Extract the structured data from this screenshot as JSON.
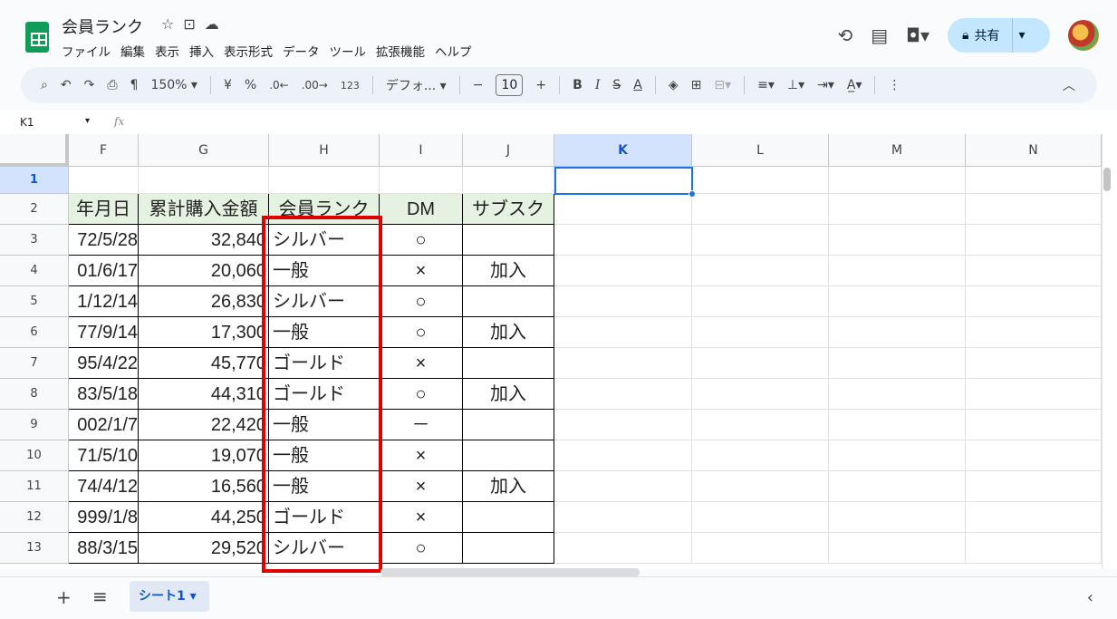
{
  "doc": {
    "title": "会員ランク"
  },
  "menu": [
    "ファイル",
    "編集",
    "表示",
    "挿入",
    "表示形式",
    "データ",
    "ツール",
    "拡張機能",
    "ヘルプ"
  ],
  "share_label": "共有",
  "toolbar": {
    "zoom": "150%",
    "currency": "¥",
    "percent": "%",
    "dec_minus": ".0←",
    "dec_plus": ".00→",
    "fmt123": "123",
    "font": "デフォ...",
    "font_size": "10",
    "bold": "B",
    "italic": "I",
    "text_color": "A"
  },
  "namebox": "K1",
  "fx": "fx",
  "columns": [
    "F",
    "G",
    "H",
    "I",
    "J",
    "K",
    "L",
    "M",
    "N"
  ],
  "selected_column": "K",
  "rows": [
    {
      "n": "1",
      "F": "",
      "G": "",
      "H": "",
      "I": "",
      "J": ""
    },
    {
      "n": "2",
      "F": "年月日",
      "G": "累計購入金額",
      "H": "会員ランク",
      "I": "DM",
      "J": "サブスク"
    },
    {
      "n": "3",
      "F": "72/5/28",
      "G": "32,840",
      "H": "シルバー",
      "I": "○",
      "J": ""
    },
    {
      "n": "4",
      "F": "01/6/17",
      "G": "20,060",
      "H": "一般",
      "I": "×",
      "J": "加入"
    },
    {
      "n": "5",
      "F": "1/12/14",
      "G": "26,830",
      "H": "シルバー",
      "I": "○",
      "J": ""
    },
    {
      "n": "6",
      "F": "77/9/14",
      "G": "17,300",
      "H": "一般",
      "I": "○",
      "J": "加入"
    },
    {
      "n": "7",
      "F": "95/4/22",
      "G": "45,770",
      "H": "ゴールド",
      "I": "×",
      "J": ""
    },
    {
      "n": "8",
      "F": "83/5/18",
      "G": "44,310",
      "H": "ゴールド",
      "I": "○",
      "J": "加入"
    },
    {
      "n": "9",
      "F": "002/1/7",
      "G": "22,420",
      "H": "一般",
      "I": "－",
      "J": ""
    },
    {
      "n": "10",
      "F": "71/5/10",
      "G": "19,070",
      "H": "一般",
      "I": "×",
      "J": ""
    },
    {
      "n": "11",
      "F": "74/4/12",
      "G": "16,560",
      "H": "一般",
      "I": "×",
      "J": "加入"
    },
    {
      "n": "12",
      "F": "999/1/8",
      "G": "44,250",
      "H": "ゴールド",
      "I": "×",
      "J": ""
    },
    {
      "n": "13",
      "F": "88/3/15",
      "G": "29,520",
      "H": "シルバー",
      "I": "○",
      "J": ""
    }
  ],
  "sheet_tab": "シート1",
  "colors": {
    "accent": "#0b57d0",
    "highlight": "#e00000",
    "header_fill": "#e6f2e1"
  }
}
